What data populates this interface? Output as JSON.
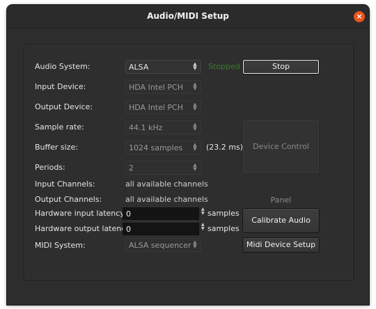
{
  "window": {
    "title": "Audio/MIDI Setup",
    "close_symbol": "×"
  },
  "form": {
    "audio_system": {
      "label": "Audio System:",
      "value": "ALSA"
    },
    "status": "Stopped",
    "stop_button": "Stop",
    "input_device": {
      "label": "Input Device:",
      "value": "HDA Intel PCH"
    },
    "output_device": {
      "label": "Output Device:",
      "value": "HDA Intel PCH"
    },
    "sample_rate": {
      "label": "Sample rate:",
      "value": "44.1 kHz"
    },
    "buffer_size": {
      "label": "Buffer size:",
      "value": "1024 samples",
      "latency": "(23.2 ms)"
    },
    "device_control_panel": "Device Control Panel",
    "periods": {
      "label": "Periods:",
      "value": "2"
    },
    "input_channels": {
      "label": "Input Channels:",
      "value": "all available channels"
    },
    "output_channels": {
      "label": "Output Channels:",
      "value": "all available channels"
    },
    "hw_input_latency": {
      "label": "Hardware input latency:",
      "value": "0",
      "unit": "samples"
    },
    "hw_output_latency": {
      "label": "Hardware output latency:",
      "value": "0",
      "unit": "samples"
    },
    "calibrate_button": "Calibrate Audio",
    "midi_system": {
      "label": "MIDI System:",
      "value": "ALSA sequencer"
    },
    "midi_device_setup_button": "Midi Device Setup"
  },
  "icons": {
    "combo_arrow": "updown-arrows-icon",
    "spin_arrow": "spin-arrows-icon",
    "close": "close-icon"
  },
  "colors": {
    "close": "#e9541f",
    "status_text": "#3a7d2a",
    "window_bg": "#2d2d2d"
  }
}
